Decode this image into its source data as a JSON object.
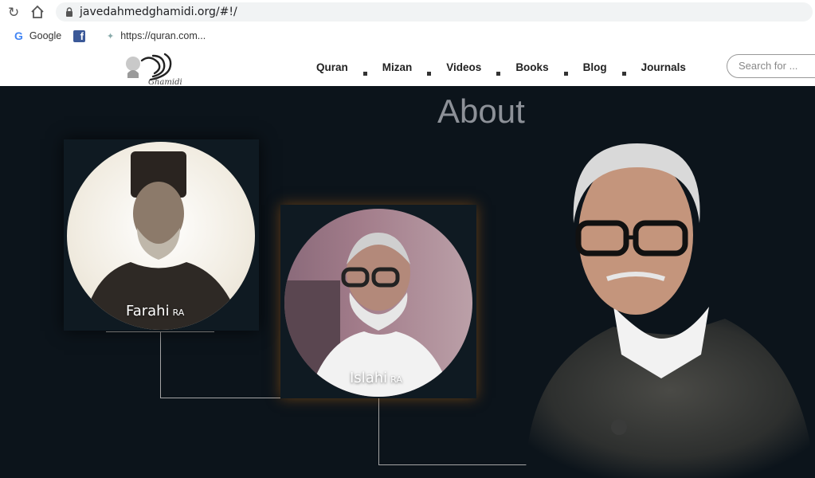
{
  "browser": {
    "url": "javedahmedghamidi.org/#!/",
    "bookmarks": [
      {
        "label": "Google",
        "icon": "google-icon"
      },
      {
        "label": "",
        "icon": "facebook-icon"
      },
      {
        "label": "https://quran.com...",
        "icon": "quran-icon"
      }
    ]
  },
  "site": {
    "logo_text": "Ghamidi",
    "nav": [
      "Quran",
      "Mizan",
      "Videos",
      "Books",
      "Blog",
      "Journals"
    ],
    "search_placeholder": "Search for ..."
  },
  "page": {
    "title": "About",
    "scholars": [
      {
        "name": "Farahi",
        "suffix": "RA"
      },
      {
        "name": "Islahi",
        "suffix": "RA"
      }
    ]
  }
}
